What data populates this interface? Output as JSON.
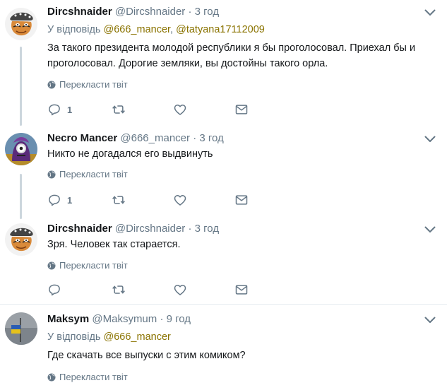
{
  "tweets": [
    {
      "name": "Dircshnaider",
      "handle": "@Dircshnaider",
      "time": "3 год",
      "reply_prefix": "У відповідь",
      "reply_user1": "@666_mancer",
      "reply_sep": ",",
      "reply_user2": "@tatyana17112009",
      "text": "За такого президента молодой республики я бы проголосовал. Приехал бы и проголосовал. Дорогие земляки, вы достойны такого орла.",
      "translate": "Перекласти твіт",
      "reply_count": "1"
    },
    {
      "name": "Necro Mancer",
      "handle": "@666_mancer",
      "time": "3 год",
      "text": "Никто не догадался его выдвинуть",
      "translate": "Перекласти твіт",
      "reply_count": "1"
    },
    {
      "name": "Dircshnaider",
      "handle": "@Dircshnaider",
      "time": "3 год",
      "text": "Зря. Человек так старается.",
      "translate": "Перекласти твіт",
      "reply_count": ""
    },
    {
      "name": "Maksym",
      "handle": "@Maksymum",
      "time": "9 год",
      "reply_prefix": "У відповідь",
      "reply_user1": "@666_mancer",
      "text": "Где скачать все выпуски с этим комиком?",
      "translate": "Перекласти твіт"
    }
  ],
  "separator_dot": "·",
  "colors": {
    "link": "#8a7300",
    "secondary": "#657786",
    "thread_line": "#ccd6dd"
  }
}
